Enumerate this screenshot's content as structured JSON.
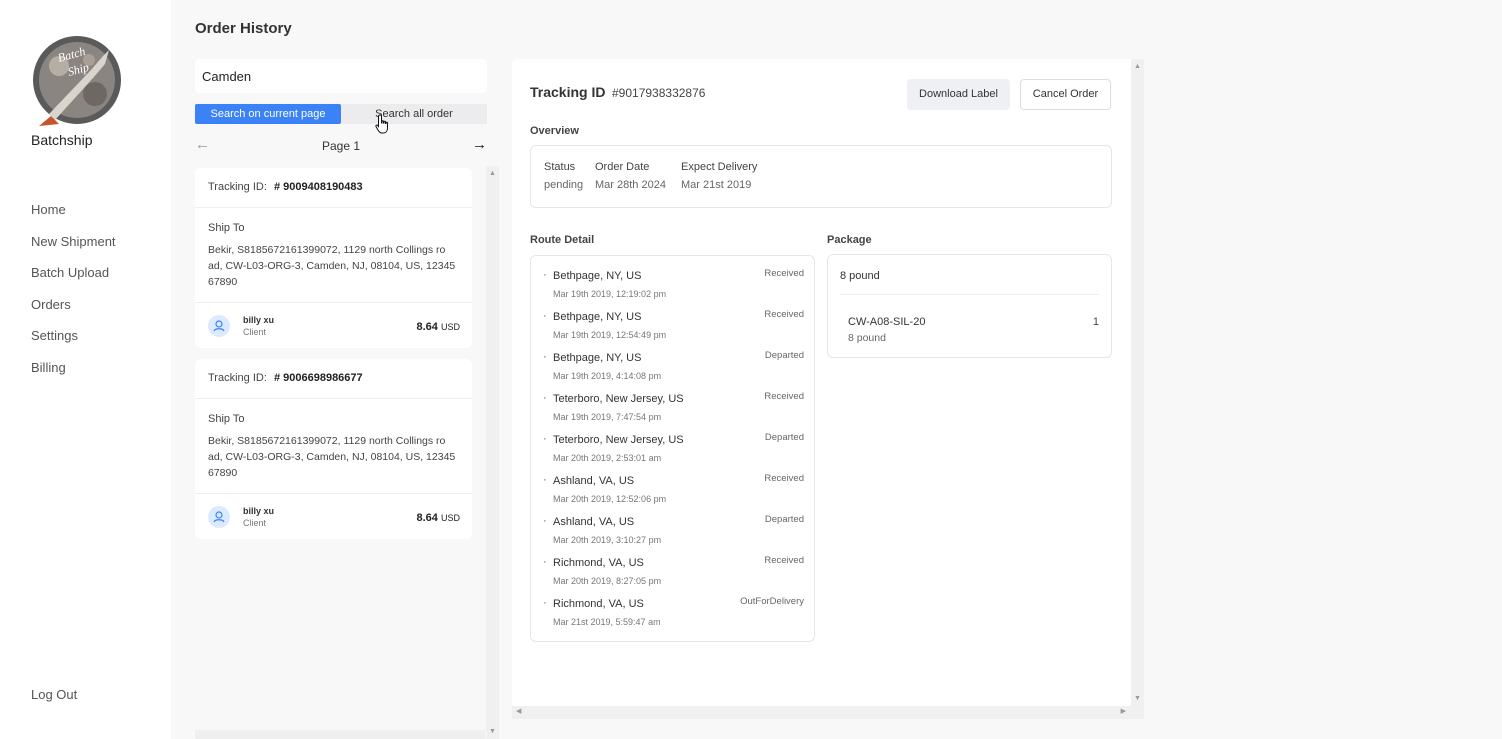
{
  "sidebar": {
    "brand": "Batchship",
    "logo_text": "Batch Ship",
    "nav": [
      "Home",
      "New Shipment",
      "Batch Upload",
      "Orders",
      "Settings",
      "Billing"
    ],
    "logout": "Log Out"
  },
  "page_title": "Order History",
  "search": {
    "value": "Camden",
    "tab_current": "Search on current page",
    "tab_all": "Search all order"
  },
  "pager": {
    "label": "Page 1",
    "prev_icon": "arrow-left-icon",
    "next_icon": "arrow-right-icon"
  },
  "orders": [
    {
      "tracking_label": "Tracking ID:",
      "tracking_id": "# 9009408190483",
      "ship_to_label": "Ship To",
      "address_lines": [
        "Bekir, S8185672161399072, 1129 north Collings ro",
        "ad, CW-L03-ORG-3, Camden, NJ, 08104, US, 12345",
        "67890"
      ],
      "client_name": "billy xu",
      "client_role": "Client",
      "amount": "8.64",
      "currency": "USD"
    },
    {
      "tracking_label": "Tracking ID:",
      "tracking_id": "# 9006698986677",
      "ship_to_label": "Ship To",
      "address_lines": [
        "Bekir, S8185672161399072, 1129 north Collings ro",
        "ad, CW-L03-ORG-3, Camden, NJ, 08104, US, 12345",
        "67890"
      ],
      "client_name": "billy xu",
      "client_role": "Client",
      "amount": "8.64",
      "currency": "USD"
    }
  ],
  "detail": {
    "tracking_label": "Tracking ID",
    "tracking_id": "#9017938332876",
    "download_label": "Download Label",
    "cancel_label": "Cancel Order",
    "overview_title": "Overview",
    "overview": {
      "status_label": "Status",
      "status_value": "pending",
      "order_date_label": "Order Date",
      "order_date_value": "Mar 28th 2024",
      "expect_label": "Expect Delivery",
      "expect_value": "Mar 21st 2019"
    },
    "route_title": "Route Detail",
    "route": [
      {
        "location": "Bethpage, NY, US",
        "time": "Mar 19th 2019, 12:19:02 pm",
        "status": "Received"
      },
      {
        "location": "Bethpage, NY, US",
        "time": "Mar 19th 2019, 12:54:49 pm",
        "status": "Received"
      },
      {
        "location": "Bethpage, NY, US",
        "time": "Mar 19th 2019, 4:14:08 pm",
        "status": "Departed"
      },
      {
        "location": "Teterboro, New Jersey, US",
        "time": "Mar 19th 2019, 7:47:54 pm",
        "status": "Received"
      },
      {
        "location": "Teterboro, New Jersey, US",
        "time": "Mar 20th 2019, 2:53:01 am",
        "status": "Departed"
      },
      {
        "location": "Ashland, VA, US",
        "time": "Mar 20th 2019, 12:52:06 pm",
        "status": "Received"
      },
      {
        "location": "Ashland, VA, US",
        "time": "Mar 20th 2019, 3:10:27 pm",
        "status": "Departed"
      },
      {
        "location": "Richmond, VA, US",
        "time": "Mar 20th 2019, 8:27:05 pm",
        "status": "Received"
      },
      {
        "location": "Richmond, VA, US",
        "time": "Mar 21st 2019, 5:59:47 am",
        "status": "OutForDelivery"
      }
    ],
    "package_title": "Package",
    "package": {
      "weight": "8 pound",
      "sku": "CW-A08-SIL-20",
      "sku_weight": "8 pound",
      "qty": "1"
    }
  },
  "colors": {
    "accent": "#3b82f6"
  }
}
